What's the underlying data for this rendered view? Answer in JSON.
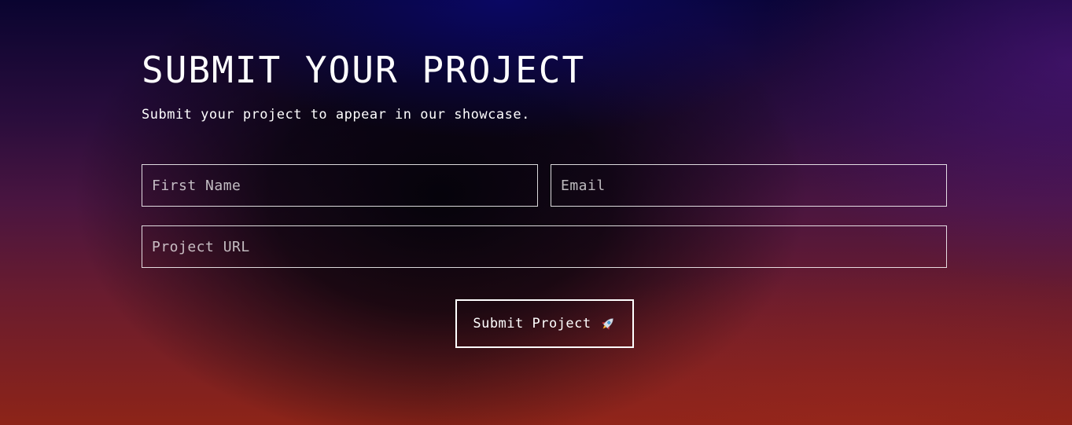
{
  "form": {
    "title": "SUBMIT YOUR PROJECT",
    "subtitle": "Submit your project to appear in our showcase.",
    "fields": {
      "first_name": {
        "placeholder": "First Name",
        "value": ""
      },
      "email": {
        "placeholder": "Email",
        "value": ""
      },
      "project_url": {
        "placeholder": "Project URL",
        "value": ""
      }
    },
    "submit_button": {
      "label": "Submit Project",
      "icon": "rocket-icon"
    }
  },
  "colors": {
    "text": "#ffffff",
    "border": "#ffffff",
    "gradient_top": "#0a0430",
    "gradient_bottom": "#8d2418"
  }
}
